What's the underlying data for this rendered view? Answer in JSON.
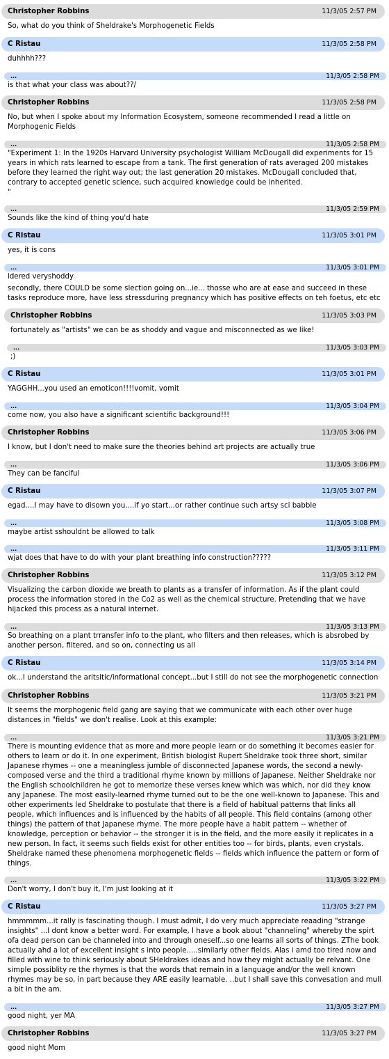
{
  "colors": {
    "christopher": "#dcdcdc",
    "ristau": "#c4dcfa"
  },
  "continuation_label": "...",
  "messages": [
    {
      "kind": "header",
      "sender": "Christopher Robbins",
      "color": "gray",
      "time": "11/3/05 2:57 PM",
      "paragraphs": [
        "So, what do you think of Sheldrake's Morphogenetic Fields"
      ]
    },
    {
      "kind": "header",
      "sender": "C Ristau",
      "color": "blue",
      "time": "11/3/05 2:58 PM",
      "paragraphs": [
        "duhhhh???"
      ]
    },
    {
      "kind": "cont",
      "color": "blue",
      "time": "11/3/05 2:58 PM",
      "paragraphs": [
        "is that what your class was about??/"
      ]
    },
    {
      "kind": "header",
      "sender": "Christopher Robbins",
      "color": "gray",
      "time": "11/3/05 2:58 PM",
      "paragraphs": [
        "No, but when I spoke about my Information Ecosystem, someone recommended I read a little on Morphogenic Fields"
      ]
    },
    {
      "kind": "cont",
      "color": "gray",
      "time": "11/3/05 2:58 PM",
      "paragraphs": [
        "\"Experiment 1: In the 1920s Harvard University psychologist William McDougall did experiments for 15 years in which rats learned to escape from a tank. The first generation of rats averaged 200 mistakes before they learned the right way out; the last generation 20 mistakes. McDougall concluded that, contrary to accepted genetic science, such acquired knowledge could be inherited.\n\"\n"
      ]
    },
    {
      "kind": "cont",
      "color": "gray",
      "time": "11/3/05 2:59 PM",
      "paragraphs": [
        "Sounds like the kind of thing you'd hate"
      ]
    },
    {
      "kind": "header",
      "sender": "C Ristau",
      "color": "blue",
      "time": "11/3/05 3:01 PM",
      "paragraphs": [
        "yes, it is cons"
      ]
    },
    {
      "kind": "cont",
      "color": "blue",
      "time": "11/3/05 3:01 PM",
      "paragraphs": [
        "idered veryshoddy",
        "secondly, there COULD be some slection going on...ie... thosse who are at ease and succeed in these tasks reproduce more, have less stressduring pregnancy which has positive effects on teh foetus, etc etc"
      ]
    },
    {
      "kind": "header",
      "sender": "Christopher Robbins",
      "color": "gray",
      "time": "11/3/05 3:03 PM",
      "indent": true,
      "paragraphs": [
        "fortunately as \"artists\" we can be as shoddy and vague and misconnected as we like!"
      ]
    },
    {
      "kind": "cont",
      "color": "gray",
      "time": "11/3/05 3:03 PM",
      "indent": true,
      "paragraphs": [
        ";)"
      ]
    },
    {
      "kind": "header",
      "sender": "C Ristau",
      "color": "blue",
      "time": "11/3/05 3:01 PM",
      "paragraphs": [
        "YAGGHH...you used an emoticon!!!!vomit, vomit"
      ]
    },
    {
      "kind": "cont",
      "color": "blue",
      "time": "11/3/05 3:04 PM",
      "paragraphs": [
        "come now, you also have a significant scientific background!!!"
      ]
    },
    {
      "kind": "header",
      "sender": "Christopher Robbins",
      "color": "gray",
      "time": "11/3/05 3:06 PM",
      "paragraphs": [
        "I know, but I don't need to make sure the theories behind art projects are actually true"
      ]
    },
    {
      "kind": "cont",
      "color": "gray",
      "time": "11/3/05 3:06 PM",
      "paragraphs": [
        "They can be fanciful"
      ]
    },
    {
      "kind": "header",
      "sender": "C Ristau",
      "color": "blue",
      "time": "11/3/05 3:07 PM",
      "paragraphs": [
        "egad....I may have to disown you....if yo start...or rather continue such artsy sci babble"
      ]
    },
    {
      "kind": "cont",
      "color": "blue",
      "time": "11/3/05 3:08 PM",
      "paragraphs": [
        "maybe artist sshouldnt be allowed to talk"
      ]
    },
    {
      "kind": "cont",
      "color": "blue",
      "time": "11/3/05 3:11 PM",
      "paragraphs": [
        "wjat does that have to do with your plant breathing info construction?????"
      ]
    },
    {
      "kind": "header",
      "sender": "Christopher Robbins",
      "color": "gray",
      "time": "11/3/05 3:12 PM",
      "paragraphs": [
        "Visualizing the carbon dioxide we breath to plants as a transfer of information. As if the plant could process the information stored in the Co2 as well as the chemical structure. Pretending that we have hijacked this process as a natural internet."
      ]
    },
    {
      "kind": "cont",
      "color": "gray",
      "time": "11/3/05 3:13 PM",
      "paragraphs": [
        "So breathing on a plant trransfer info to the plant, who filters and then releases, which is absrobed by another person, filtered, and so on, connecting us all"
      ]
    },
    {
      "kind": "header",
      "sender": "C Ristau",
      "color": "blue",
      "time": "11/3/05 3:14 PM",
      "paragraphs": [
        "ok...I understand the aritsitic/informational concept...but I still do not see the morphogenetic connection"
      ]
    },
    {
      "kind": "header",
      "sender": "Christopher Robbins",
      "color": "gray",
      "time": "11/3/05 3:21 PM",
      "paragraphs": [
        "It seems the morphogenic field gang are saying that we communicate with each other over huge distances in \"fields\" we don't realise. Look at this example:"
      ]
    },
    {
      "kind": "cont",
      "color": "gray",
      "time": "11/3/05 3:21 PM",
      "paragraphs": [
        "There is mounting evidence that as more and more people learn or do something it becomes easier for others to learn or do it. In one experiment, British biologist Rupert Sheldrake took three short, similar Japanese rhymes -- one a meaningless jumble of disconnected Japanese words, the second a newly-composed verse and the third a traditional rhyme known by millions of Japanese. Neither Sheldrake nor the English schoolchildren he got to memorize these verses knew which was which, nor did they know any Japanese. The most easily-learned rhyme turned out to be the one well-known to Japanese. This and other experiments led Sheldrake to postulate that there is a field of habitual patterns that links all people, which influences and is influenced by the habits of all people. This field contains (among other things) the pattern of that Japanese rhyme. The more people have a habit pattern -- whether of knowledge, perception or behavior -- the stronger it is in the field, and the more easily it replicates in a new person. In fact, it seems such fields exist for other entities too -- for birds, plants, even crystals. Sheldrake named these phenomena morphogenetic fields -- fields which influence the pattern or form of things."
      ]
    },
    {
      "kind": "cont",
      "color": "gray",
      "time": "11/3/05 3:22 PM",
      "paragraphs": [
        "Don't worry, I don't buy it, I'm just looking at it"
      ]
    },
    {
      "kind": "header",
      "sender": "C Ristau",
      "color": "blue",
      "time": "11/3/05 3:27 PM",
      "paragraphs": [
        "hmmmmm...it rally is fascinating though. I must admit, I do very much appreciate reaading \"strange insights\" ...I dont know a better word. For example, I have a book about \"channeling\" whereby the spirt ofa dead person can be channeled into and through oneself...so one learns all sorts of things. ZThe book actually ahd a lot of excellent insight s into people.....similarly other fields. Alas i amd too tired now and filled with wine to think seriously about SHeldrakes ideas and how they might actually be relvant. One simple possiblity re the rhymes is that the words that remain in a language and/or the well known rhymes may be so, in part because they ARE easily learnable. ..but I shall save this convesation and mull a bit in the am."
      ]
    },
    {
      "kind": "cont",
      "color": "blue",
      "time": "11/3/05 3:27 PM",
      "paragraphs": [
        "good night, yer MA"
      ]
    },
    {
      "kind": "header",
      "sender": "Christopher Robbins",
      "color": "gray",
      "time": "11/3/05 3:27 PM",
      "paragraphs": [
        "good night Mom"
      ]
    }
  ]
}
